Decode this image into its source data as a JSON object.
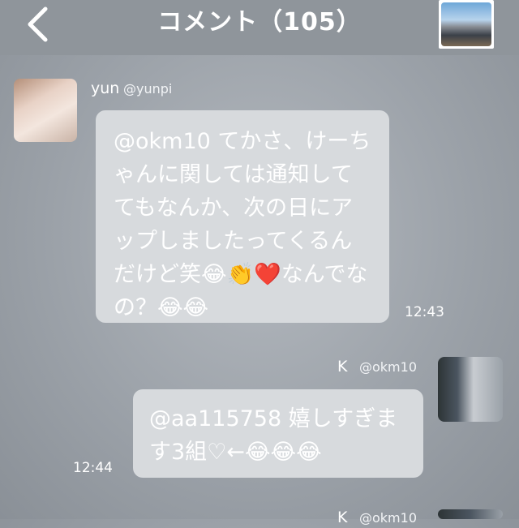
{
  "header": {
    "title": "コメント（105）"
  },
  "comments": [
    {
      "name": "yun",
      "handle": "@yunpi",
      "text": "@okm10 てかさ、けーちゃんに関しては通知しててもなんか、次の日にアップしましたってくるんだけど笑😂👏❤️なんでなの？😂😂",
      "time": "12:43"
    },
    {
      "name": "K",
      "handle": "@okm10",
      "text": "@aa115758 嬉しすぎます3組♡←😂😂😂",
      "time": "12:44"
    },
    {
      "name": "K",
      "handle": "@okm10"
    }
  ],
  "icons": {
    "back": "chevron-left-icon"
  },
  "colors": {
    "header": "#8f959b",
    "bubble": "#d7dadd",
    "text": "#ffffff"
  }
}
